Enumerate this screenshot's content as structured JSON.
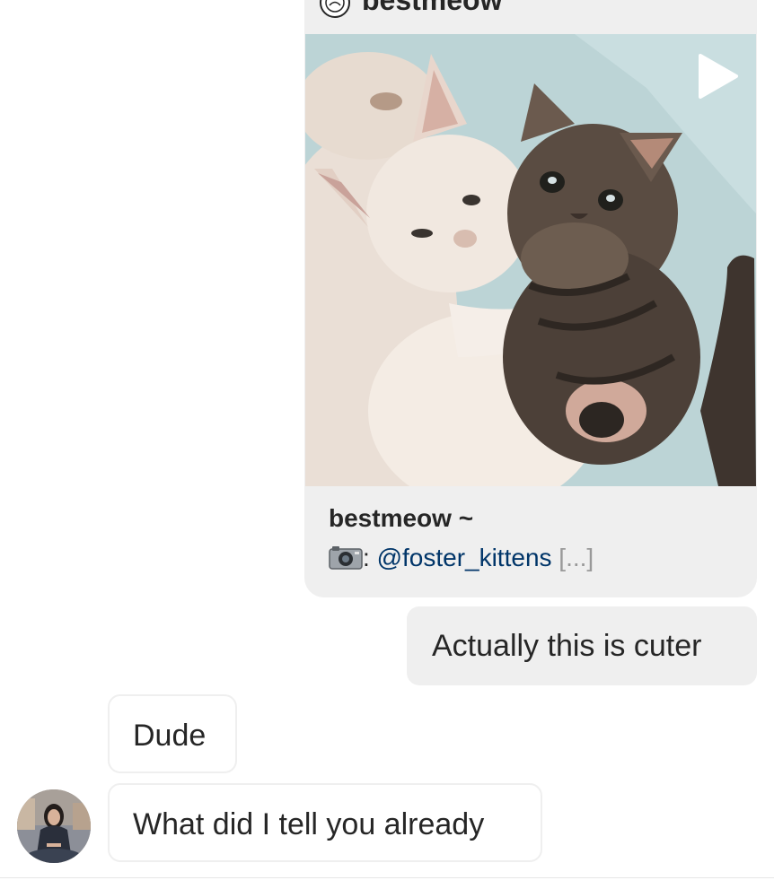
{
  "shared_post": {
    "username": "bestmeow",
    "title": "bestmeow ~",
    "caption_mention": "@foster_kittens",
    "caption_prefix": ":",
    "caption_more": "[...]",
    "media_type": "video",
    "icons": {
      "account": "account-logo-icon",
      "chevron": "chevron-right-icon",
      "play": "play-icon",
      "camera": "camera-emoji-icon"
    }
  },
  "messages": [
    {
      "from": "me",
      "text": "Actually this is cuter"
    },
    {
      "from": "them",
      "text": "Dude"
    },
    {
      "from": "them",
      "text": "What did I tell you already"
    }
  ],
  "colors": {
    "sent_bubble": "#efefef",
    "received_border": "#efefef",
    "mention_link": "#003569",
    "muted": "#999999",
    "text": "#262626"
  }
}
